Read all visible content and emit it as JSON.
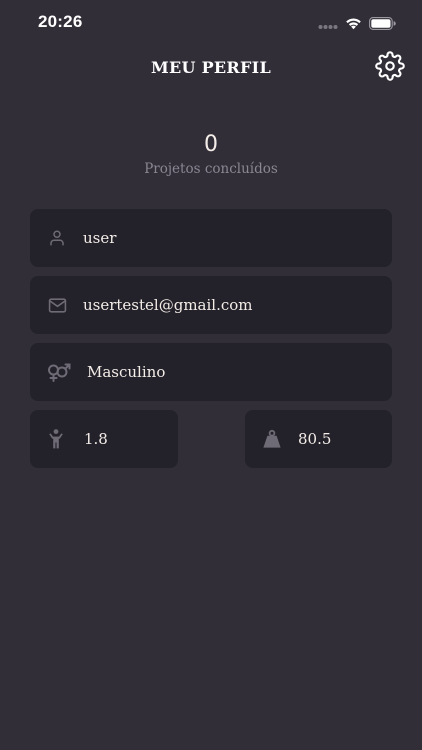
{
  "status_bar": {
    "time": "20:26",
    "icons": [
      "signal-dots-icon",
      "wifi-icon",
      "battery-icon"
    ]
  },
  "header": {
    "title": "MEU PERFIL",
    "settings_icon": "gear-icon"
  },
  "stats": {
    "projects_done_value": "0",
    "projects_done_label": "Projetos concluídos"
  },
  "profile": {
    "name": "user",
    "email": "usertestel@gmail.com",
    "gender": "Masculino",
    "height": "1.8",
    "weight": "80.5"
  },
  "colors": {
    "background": "#312e38",
    "field_background": "#232129",
    "text": "#f4ede8",
    "muted_text": "#8a8792",
    "icon": "#6f6b76"
  }
}
